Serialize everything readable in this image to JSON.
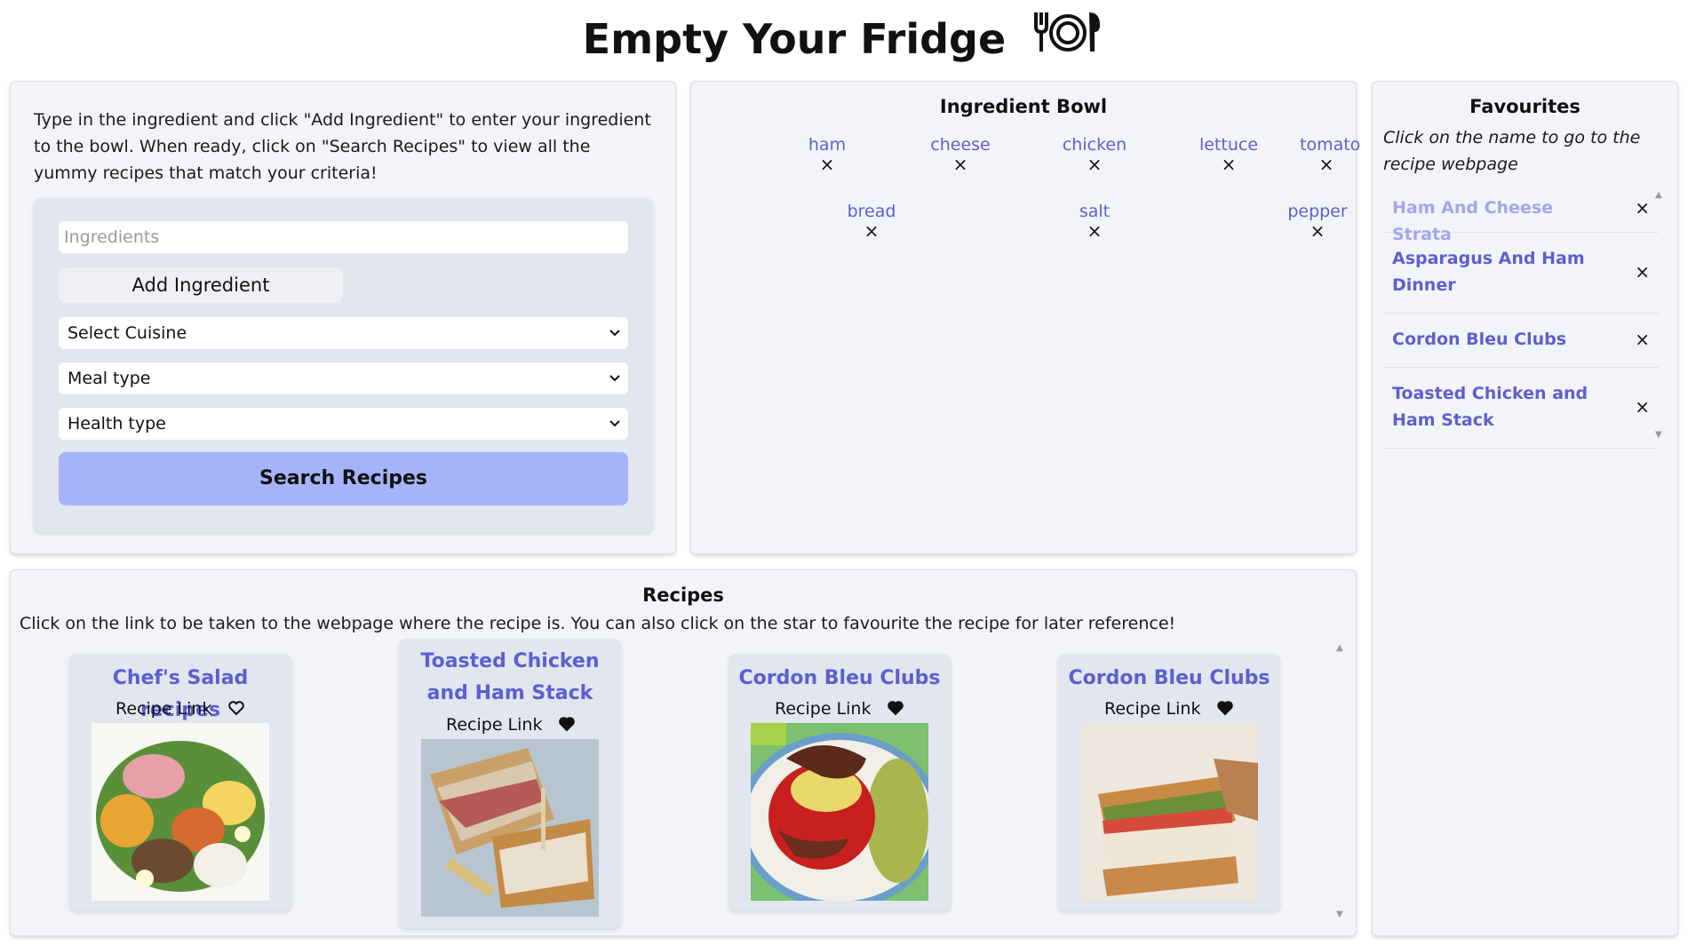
{
  "app": {
    "title": "Empty Your Fridge"
  },
  "input_panel": {
    "instructions": "Type in the ingredient and click \"Add Ingredient\" to enter your ingredient to the bowl. When ready, click on \"Search Recipes\" to view all the yummy recipes that match your criteria!",
    "ingredient_placeholder": "Ingredients",
    "add_button": "Add Ingredient",
    "cuisine_select": "Select Cuisine",
    "meal_select": "Meal type",
    "health_select": "Health type",
    "search_button": "Search Recipes"
  },
  "bowl": {
    "title": "Ingredient Bowl",
    "remove_glyph": "×",
    "ingredients": [
      "ham",
      "cheese",
      "chicken",
      "lettuce",
      "tomato",
      "bread",
      "salt",
      "pepper"
    ]
  },
  "favourites": {
    "title": "Favourites",
    "subtitle": "Click on the name to go to the recipe webpage",
    "remove_glyph": "×",
    "items": [
      {
        "name": "Ham And Cheese Strata"
      },
      {
        "name": "Asparagus And Ham Dinner"
      },
      {
        "name": "Cordon Bleu Clubs"
      },
      {
        "name": "Toasted Chicken and Ham Stack"
      }
    ]
  },
  "recipes": {
    "title": "Recipes",
    "subtitle": "Click on the link to be taken to the webpage where the recipe is. You can also click on the star to favourite the recipe for later reference!",
    "link_label": "Recipe Link",
    "cards": [
      {
        "title": "Chef's Salad recipes",
        "favourited": false
      },
      {
        "title": "Toasted Chicken and Ham Stack",
        "favourited": true
      },
      {
        "title": "Cordon Bleu Clubs",
        "favourited": true
      },
      {
        "title": "Cordon Bleu Clubs",
        "favourited": true
      }
    ]
  },
  "icons": {
    "logo": "cutlery-plate-icon",
    "chevron": "chevron-down-icon",
    "heart_empty": "heart-outline-icon",
    "heart_full": "heart-filled-icon"
  },
  "colors": {
    "accent_link": "#5d5fcf",
    "search_button": "#a4b3fa",
    "panel_bg": "#f2f4f8"
  }
}
